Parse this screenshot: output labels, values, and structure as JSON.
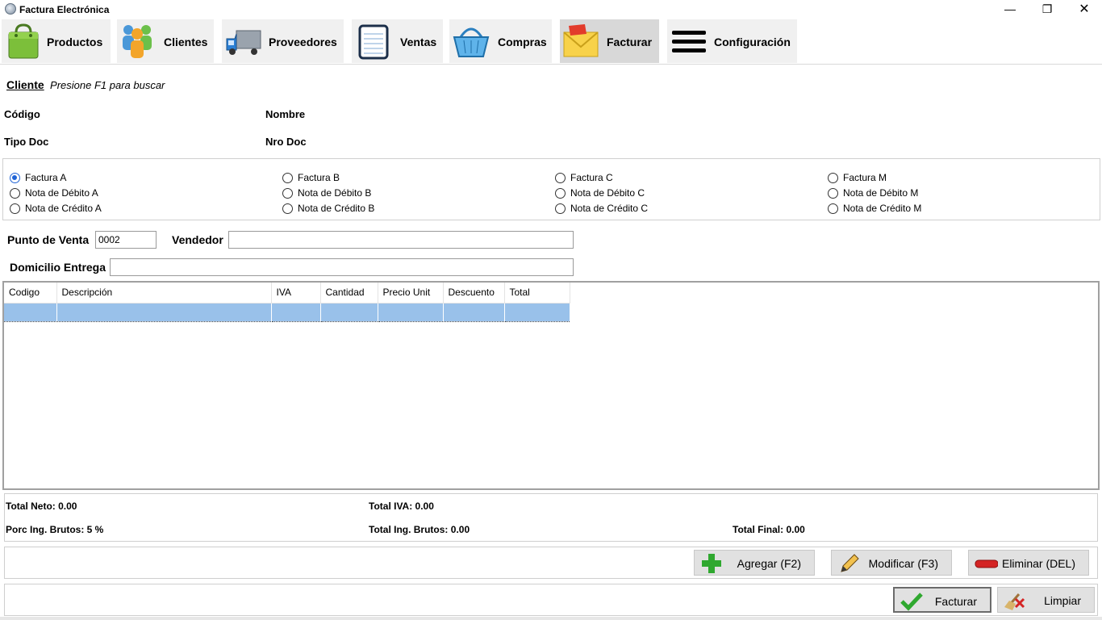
{
  "window": {
    "title": "Factura Electrónica",
    "minimize": "—",
    "maximize": "❐",
    "close": "✕"
  },
  "toolbar": [
    {
      "label": "Productos",
      "icon": "shopping-bag-icon"
    },
    {
      "label": "Clientes",
      "icon": "users-icon"
    },
    {
      "label": "Proveedores",
      "icon": "truck-icon"
    },
    {
      "label": "Ventas",
      "icon": "notepad-icon"
    },
    {
      "label": "Compras",
      "icon": "basket-icon"
    },
    {
      "label": "Facturar",
      "icon": "envelope-icon",
      "active": true
    },
    {
      "label": "Configuración",
      "icon": "menu-icon"
    }
  ],
  "cliente": {
    "title": "Cliente",
    "hint": "Presione F1 para buscar",
    "codigo_label": "Código",
    "nombre_label": "Nombre",
    "tipo_doc_label": "Tipo Doc",
    "nro_doc_label": "Nro Doc"
  },
  "tipos": [
    [
      "Factura A",
      "Nota de Débito A",
      "Nota de Crédito A"
    ],
    [
      "Factura B",
      "Nota de Débito B",
      "Nota de Crédito B"
    ],
    [
      "Factura C",
      "Nota de Débito C",
      "Nota de Crédito C"
    ],
    [
      "Factura M",
      "Nota de Débito M",
      "Nota de Crédito M"
    ]
  ],
  "selected_tipo": "Factura A",
  "form": {
    "punto_venta_label": "Punto de Venta",
    "punto_venta_value": "0002",
    "vendedor_label": "Vendedor",
    "vendedor_value": "",
    "domicilio_label": "Domicilio Entrega",
    "domicilio_value": ""
  },
  "grid": {
    "columns": [
      "Codigo",
      "Descripción",
      "IVA",
      "Cantidad",
      "Precio Unit",
      "Descuento",
      "Total"
    ]
  },
  "totals": {
    "neto": "Total Neto: 0.00",
    "iva": "Total IVA: 0.00",
    "porc_ing_brutos": "Porc Ing. Brutos: 5 %",
    "total_ing_brutos": "Total Ing. Brutos: 0.00",
    "final": "Total Final: 0.00"
  },
  "buttons": {
    "agregar": "Agregar (F2)",
    "modificar": "Modificar (F3)",
    "eliminar": "Eliminar (DEL)",
    "facturar": "Facturar",
    "limpiar": "Limpiar"
  }
}
